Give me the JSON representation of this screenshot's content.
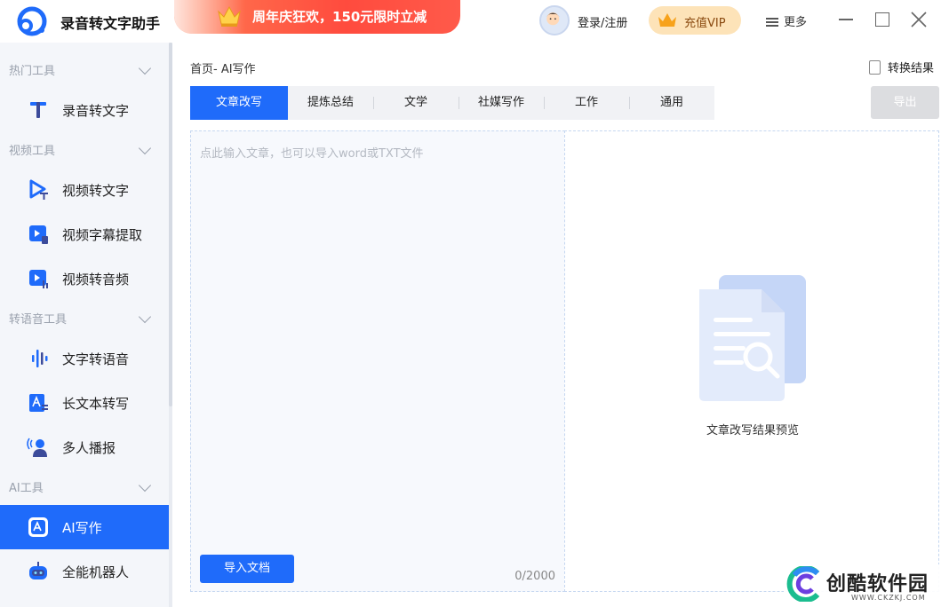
{
  "app": {
    "title": "录音转文字助手"
  },
  "promo": {
    "text": "周年庆狂欢，150元限时立减"
  },
  "header": {
    "login": "登录/注册",
    "vip": "充值VIP",
    "more": "更多"
  },
  "sidebar": {
    "groups": [
      {
        "label": "热门工具",
        "items": [
          {
            "label": "录音转文字",
            "icon": "t-letter-icon"
          }
        ]
      },
      {
        "label": "视频工具",
        "items": [
          {
            "label": "视频转文字",
            "icon": "video-text-icon"
          },
          {
            "label": "视频字幕提取",
            "icon": "subtitle-icon"
          },
          {
            "label": "视频转音频",
            "icon": "video-audio-icon"
          }
        ]
      },
      {
        "label": "转语音工具",
        "items": [
          {
            "label": "文字转语音",
            "icon": "waveform-icon"
          },
          {
            "label": "长文本转写",
            "icon": "long-text-icon"
          },
          {
            "label": "多人播报",
            "icon": "broadcast-icon"
          }
        ]
      },
      {
        "label": "AI工具",
        "items": [
          {
            "label": "AI写作",
            "icon": "ai-write-icon",
            "active": true
          },
          {
            "label": "全能机器人",
            "icon": "robot-icon"
          }
        ]
      }
    ]
  },
  "main": {
    "breadcrumb": "首页- AI写作",
    "result_link": "转换结果",
    "tabs": [
      "文章改写",
      "提炼总结",
      "文学",
      "社媒写作",
      "工作",
      "通用"
    ],
    "active_tab": 0,
    "export": "导出",
    "editor": {
      "placeholder": "点此输入文章，也可以导入word或TXT文件",
      "import": "导入文档",
      "counter": "0/2000"
    },
    "preview": {
      "text": "文章改写结果预览"
    }
  },
  "watermark": {
    "text": "创酷软件园",
    "url": "WWW.CKZKJ.COM"
  },
  "colors": {
    "accent": "#1f6bfa",
    "promo": "#ff4b3e",
    "vip_bg": "#fde3b8"
  }
}
